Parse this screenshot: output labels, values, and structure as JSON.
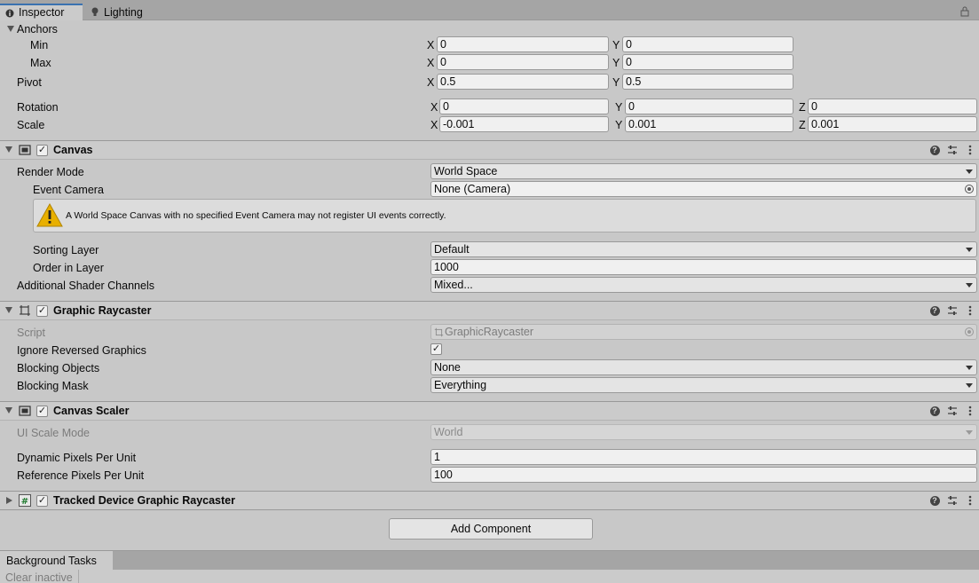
{
  "tabs": {
    "inspector": "Inspector",
    "lighting": "Lighting"
  },
  "transform": {
    "anchors": "Anchors",
    "min": {
      "label": "Min",
      "x": "0",
      "y": "0"
    },
    "max": {
      "label": "Max",
      "x": "0",
      "y": "0"
    },
    "pivot": {
      "label": "Pivot",
      "x": "0.5",
      "y": "0.5"
    },
    "rotation": {
      "label": "Rotation",
      "x": "0",
      "y": "0",
      "z": "0"
    },
    "scale": {
      "label": "Scale",
      "x": "-0.001",
      "y": "0.001",
      "z": "0.001"
    },
    "axis_x": "X",
    "axis_y": "Y",
    "axis_z": "Z"
  },
  "canvas": {
    "title": "Canvas",
    "enabled": "✓",
    "render_mode": {
      "label": "Render Mode",
      "value": "World Space"
    },
    "event_camera": {
      "label": "Event Camera",
      "value": "None (Camera)"
    },
    "warning": "A World Space Canvas with no specified Event Camera may not register UI events correctly.",
    "sorting_layer": {
      "label": "Sorting Layer",
      "value": "Default"
    },
    "order_in_layer": {
      "label": "Order in Layer",
      "value": "1000"
    },
    "shader_channels": {
      "label": "Additional Shader Channels",
      "value": "Mixed..."
    }
  },
  "raycaster": {
    "title": "Graphic Raycaster",
    "enabled": "✓",
    "script": {
      "label": "Script",
      "value": "GraphicRaycaster"
    },
    "ignore_reversed": {
      "label": "Ignore Reversed Graphics",
      "value": "✓"
    },
    "blocking_objects": {
      "label": "Blocking Objects",
      "value": "None"
    },
    "blocking_mask": {
      "label": "Blocking Mask",
      "value": "Everything"
    }
  },
  "scaler": {
    "title": "Canvas Scaler",
    "enabled": "✓",
    "ui_scale_mode": {
      "label": "UI Scale Mode",
      "value": "World"
    },
    "dynamic_ppu": {
      "label": "Dynamic Pixels Per Unit",
      "value": "1"
    },
    "reference_ppu": {
      "label": "Reference Pixels Per Unit",
      "value": "100"
    }
  },
  "tracked": {
    "title": "Tracked Device Graphic Raycaster",
    "enabled": "✓"
  },
  "add_component": "Add Component",
  "background_tasks": {
    "tab": "Background Tasks",
    "clear_inactive": "Clear inactive"
  },
  "icons": {
    "help": "?"
  },
  "colors": {
    "panel_bg": "#c8c8c8",
    "tab_bar": "#a5a5a5",
    "active_tab_accent": "#3a72b0",
    "warning": "#e8b000"
  }
}
